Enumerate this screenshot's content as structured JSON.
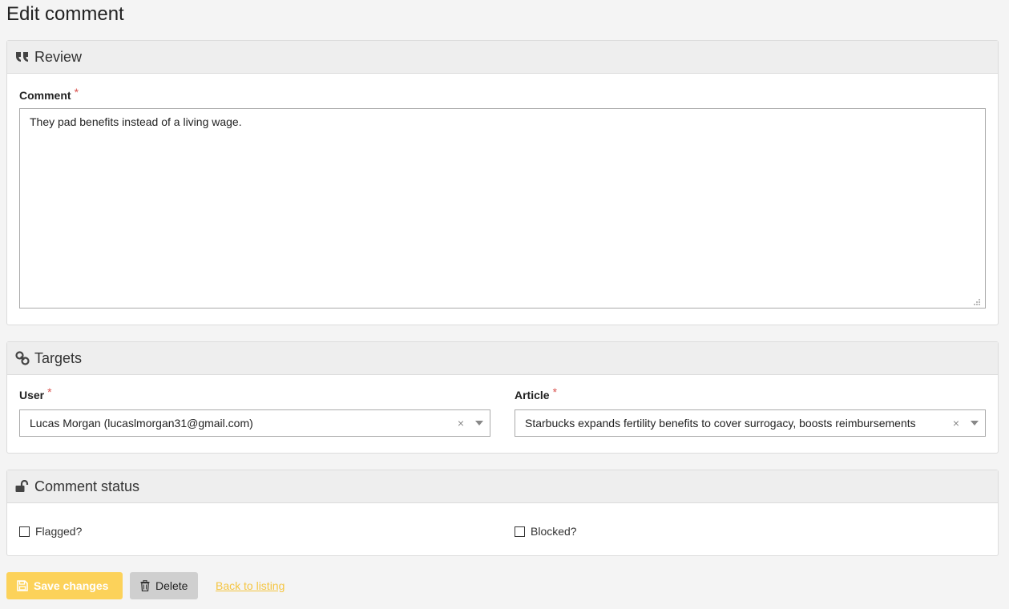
{
  "page": {
    "title": "Edit comment"
  },
  "review": {
    "heading": "Review",
    "icon": "quote-icon",
    "comment_label": "Comment",
    "required_mark": "*",
    "comment_value": "They pad benefits instead of a living wage."
  },
  "targets": {
    "heading": "Targets",
    "icon": "link-icon",
    "user_label": "User",
    "user_value": "Lucas Morgan (lucaslmorgan31@gmail.com)",
    "article_label": "Article",
    "article_value": "Starbucks expands fertility benefits to cover surrogacy, boosts reimbursements",
    "clear_glyph": "×",
    "required_mark": "*"
  },
  "status": {
    "heading": "Comment status",
    "icon": "unlock-icon",
    "flagged_label": "Flagged?",
    "flagged_checked": false,
    "blocked_label": "Blocked?",
    "blocked_checked": false
  },
  "actions": {
    "save_label": "Save changes",
    "delete_label": "Delete",
    "back_label": "Back to listing"
  },
  "colors": {
    "save_bg": "#fcd25a",
    "delete_bg": "#cfcfcf",
    "link": "#f5c542",
    "required": "#d9534f"
  }
}
